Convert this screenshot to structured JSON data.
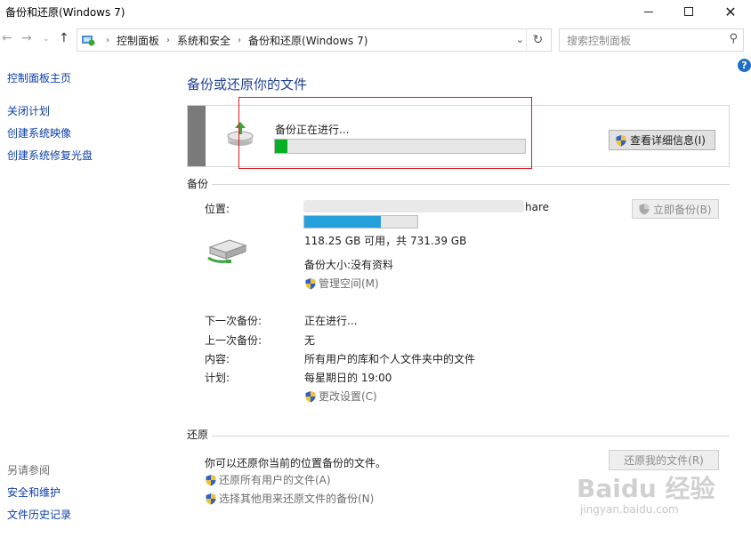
{
  "window": {
    "title": "备份和还原(Windows 7)",
    "minimize": "—",
    "close": "✕"
  },
  "nav": {
    "back": "←",
    "forward": "→",
    "recent": "⌄",
    "up": "↑",
    "breadcrumbs": [
      "控制面板",
      "系统和安全",
      "备份和还原(Windows 7)"
    ],
    "crumb_sep": "›",
    "dropdown": "⌄",
    "refresh": "↻",
    "search_placeholder": "搜索控制面板",
    "search_icon": "⚲"
  },
  "help": "?",
  "sidebar": {
    "home": "控制面板主页",
    "links": [
      "关闭计划",
      "创建系统映像",
      "创建系统修复光盘"
    ],
    "see_also_head": "另请参阅",
    "see_also": [
      "安全和维护",
      "文件历史记录"
    ]
  },
  "main": {
    "title": "备份或还原你的文件",
    "progress": {
      "label": "备份正在进行...",
      "fraction": 0.05,
      "details_button": "查看详细信息(I)"
    },
    "backup": {
      "section": "备份",
      "location_label": "位置:",
      "location_value_suffix": "hare",
      "capacity_fraction": 0.68,
      "capacity_text": "118.25 GB 可用，共 731.39 GB",
      "size_text": "备份大小:没有资料",
      "manage_space": "管理空间(M)",
      "backup_now": "立即备份(B)",
      "rows": [
        {
          "label": "下一次备份:",
          "value": "正在进行..."
        },
        {
          "label": "上一次备份:",
          "value": "无"
        },
        {
          "label": "内容:",
          "value": "所有用户的库和个人文件夹中的文件"
        },
        {
          "label": "计划:",
          "value": "每星期日的 19:00"
        }
      ],
      "change_settings": "更改设置(C)"
    },
    "restore": {
      "section": "还原",
      "description": "你可以还原你当前的位置备份的文件。",
      "restore_my_files": "还原我的文件(R)",
      "restore_all_users": "还原所有用户的文件(A)",
      "select_other": "选择其他用来还原文件的备份(N)"
    }
  },
  "watermark": {
    "brand": "Baidu 经验",
    "url": "jingyan.baidu.com"
  },
  "colors": {
    "accent": "#1c3f94",
    "link": "#0b3ea8",
    "progress": "#06b025",
    "capacity": "#26a0da",
    "highlight": "#d81e1e"
  }
}
